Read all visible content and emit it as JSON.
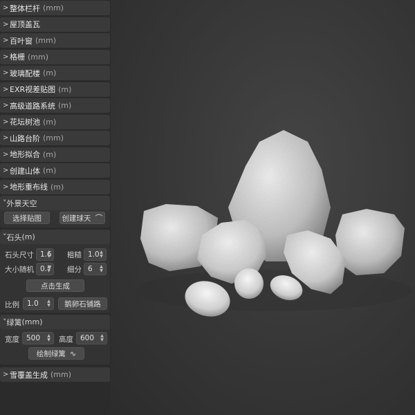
{
  "sidebar": {
    "collapsed_sections": [
      {
        "label": "整体栏杆",
        "unit": "(mm)"
      },
      {
        "label": "屋顶盖瓦",
        "unit": ""
      },
      {
        "label": "百叶窗",
        "unit": "(mm)"
      },
      {
        "label": "格栅",
        "unit": "(mm)"
      },
      {
        "label": "玻璃配楼",
        "unit": "(m)"
      },
      {
        "label": "EXR视差贴图",
        "unit": "(m)"
      },
      {
        "label": "高级道路系统",
        "unit": "(m)"
      },
      {
        "label": "花坛树池",
        "unit": "(m)"
      },
      {
        "label": "山路台阶",
        "unit": "(mm)"
      },
      {
        "label": "地形拟合",
        "unit": "(m)"
      },
      {
        "label": "创建山体",
        "unit": "(m)"
      },
      {
        "label": "地形重布线",
        "unit": "(m)"
      }
    ],
    "sky": {
      "title": "外景天空",
      "select_texture": "选择贴图",
      "create_sky": "创建球天"
    },
    "stone": {
      "title": "石头",
      "unit": "(m)",
      "size_label": "石头尺寸",
      "size_value": "1.6",
      "rough_label": "粗糙",
      "rough_value": "1.0",
      "random_label": "大小随机",
      "random_value": "0.7",
      "subdiv_label": "细分",
      "subdiv_value": "6",
      "generate": "点击生成",
      "scale_label": "比例",
      "scale_value": "1.0",
      "pebble_path": "鹅卵石铺路"
    },
    "hedge": {
      "title": "绿篱",
      "unit": "(mm)",
      "width_label": "宽度",
      "width_value": "500",
      "height_label": "高度",
      "height_value": "600",
      "draw": "绘制绿篱"
    },
    "snow": {
      "label": "雪覆盖生成",
      "unit": "(mm)"
    }
  },
  "icons": {
    "chevron_right": "chevron-right-icon",
    "chevron_down": "chevron-down-icon",
    "arc": "arc-icon",
    "wave": "wave-icon"
  },
  "viewport": {
    "content": "stones-render"
  }
}
